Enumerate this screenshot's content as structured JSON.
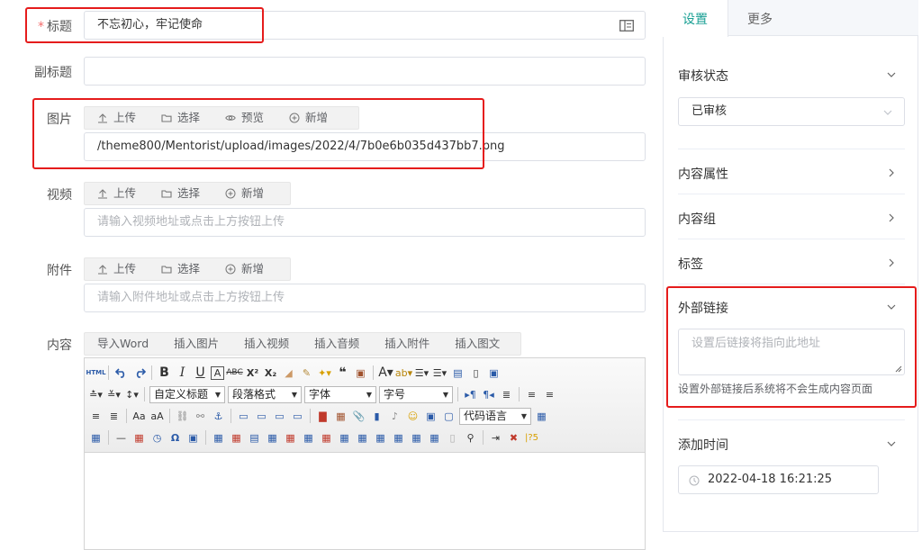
{
  "form": {
    "title_label": "标题",
    "title_required": "*",
    "title_value": "不忘初心，牢记使命",
    "subtitle_label": "副标题",
    "subtitle_value": "",
    "image_label": "图片",
    "image_buttons": [
      "上传",
      "选择",
      "预览",
      "新增"
    ],
    "image_value": "/theme800/Mentorist/upload/images/2022/4/7b0e6b035d437bb7.png",
    "video_label": "视频",
    "video_buttons": [
      "上传",
      "选择",
      "新增"
    ],
    "video_placeholder": "请输入视频地址或点击上方按钮上传",
    "attach_label": "附件",
    "attach_buttons": [
      "上传",
      "选择",
      "新增"
    ],
    "attach_placeholder": "请输入附件地址或点击上方按钮上传",
    "content_label": "内容",
    "content_buttons": [
      "导入Word",
      "插入图片",
      "插入视频",
      "插入音频",
      "插入附件",
      "插入图文"
    ]
  },
  "editor": {
    "dropdowns": {
      "custom_title": "自定义标题",
      "paragraph": "段落格式",
      "font": "字体",
      "size": "字号",
      "code_lang": "代码语言"
    },
    "html_btn": "HTML"
  },
  "sidebar": {
    "tabs": [
      "设置",
      "更多"
    ],
    "active_tab": "设置",
    "review_label": "审核状态",
    "review_value": "已审核",
    "attr_label": "内容属性",
    "group_label": "内容组",
    "tag_label": "标签",
    "extlink_label": "外部链接",
    "extlink_placeholder": "设置后链接将指向此地址",
    "extlink_hint": "设置外部链接后系统将不会生成内容页面",
    "time_label": "添加时间",
    "time_value": "2022-04-18 16:21:25"
  },
  "colors": {
    "accent": "#1aa094",
    "highlight": "#e51c1c"
  }
}
